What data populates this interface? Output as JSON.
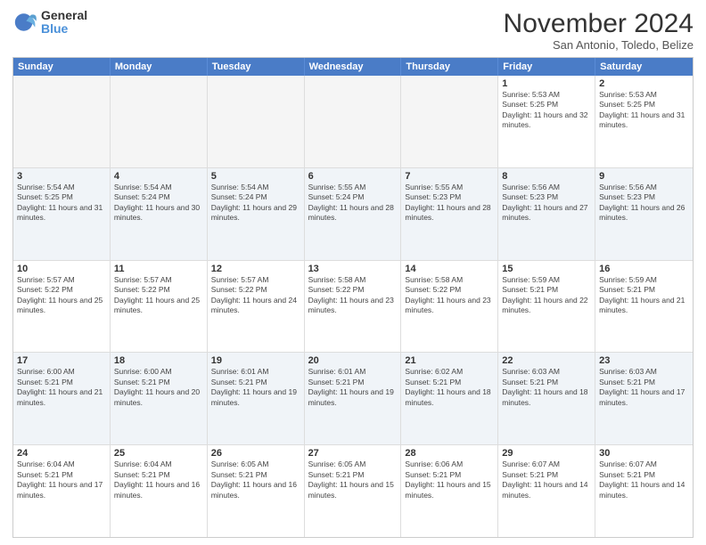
{
  "logo": {
    "line1": "General",
    "line2": "Blue"
  },
  "title": "November 2024",
  "location": "San Antonio, Toledo, Belize",
  "days_of_week": [
    "Sunday",
    "Monday",
    "Tuesday",
    "Wednesday",
    "Thursday",
    "Friday",
    "Saturday"
  ],
  "weeks": [
    [
      {
        "day": "",
        "empty": true
      },
      {
        "day": "",
        "empty": true
      },
      {
        "day": "",
        "empty": true
      },
      {
        "day": "",
        "empty": true
      },
      {
        "day": "",
        "empty": true
      },
      {
        "day": "1",
        "sunrise": "5:53 AM",
        "sunset": "5:25 PM",
        "daylight": "11 hours and 32 minutes."
      },
      {
        "day": "2",
        "sunrise": "5:53 AM",
        "sunset": "5:25 PM",
        "daylight": "11 hours and 31 minutes."
      }
    ],
    [
      {
        "day": "3",
        "sunrise": "5:54 AM",
        "sunset": "5:25 PM",
        "daylight": "11 hours and 31 minutes."
      },
      {
        "day": "4",
        "sunrise": "5:54 AM",
        "sunset": "5:24 PM",
        "daylight": "11 hours and 30 minutes."
      },
      {
        "day": "5",
        "sunrise": "5:54 AM",
        "sunset": "5:24 PM",
        "daylight": "11 hours and 29 minutes."
      },
      {
        "day": "6",
        "sunrise": "5:55 AM",
        "sunset": "5:24 PM",
        "daylight": "11 hours and 28 minutes."
      },
      {
        "day": "7",
        "sunrise": "5:55 AM",
        "sunset": "5:23 PM",
        "daylight": "11 hours and 28 minutes."
      },
      {
        "day": "8",
        "sunrise": "5:56 AM",
        "sunset": "5:23 PM",
        "daylight": "11 hours and 27 minutes."
      },
      {
        "day": "9",
        "sunrise": "5:56 AM",
        "sunset": "5:23 PM",
        "daylight": "11 hours and 26 minutes."
      }
    ],
    [
      {
        "day": "10",
        "sunrise": "5:57 AM",
        "sunset": "5:22 PM",
        "daylight": "11 hours and 25 minutes."
      },
      {
        "day": "11",
        "sunrise": "5:57 AM",
        "sunset": "5:22 PM",
        "daylight": "11 hours and 25 minutes."
      },
      {
        "day": "12",
        "sunrise": "5:57 AM",
        "sunset": "5:22 PM",
        "daylight": "11 hours and 24 minutes."
      },
      {
        "day": "13",
        "sunrise": "5:58 AM",
        "sunset": "5:22 PM",
        "daylight": "11 hours and 23 minutes."
      },
      {
        "day": "14",
        "sunrise": "5:58 AM",
        "sunset": "5:22 PM",
        "daylight": "11 hours and 23 minutes."
      },
      {
        "day": "15",
        "sunrise": "5:59 AM",
        "sunset": "5:21 PM",
        "daylight": "11 hours and 22 minutes."
      },
      {
        "day": "16",
        "sunrise": "5:59 AM",
        "sunset": "5:21 PM",
        "daylight": "11 hours and 21 minutes."
      }
    ],
    [
      {
        "day": "17",
        "sunrise": "6:00 AM",
        "sunset": "5:21 PM",
        "daylight": "11 hours and 21 minutes."
      },
      {
        "day": "18",
        "sunrise": "6:00 AM",
        "sunset": "5:21 PM",
        "daylight": "11 hours and 20 minutes."
      },
      {
        "day": "19",
        "sunrise": "6:01 AM",
        "sunset": "5:21 PM",
        "daylight": "11 hours and 19 minutes."
      },
      {
        "day": "20",
        "sunrise": "6:01 AM",
        "sunset": "5:21 PM",
        "daylight": "11 hours and 19 minutes."
      },
      {
        "day": "21",
        "sunrise": "6:02 AM",
        "sunset": "5:21 PM",
        "daylight": "11 hours and 18 minutes."
      },
      {
        "day": "22",
        "sunrise": "6:03 AM",
        "sunset": "5:21 PM",
        "daylight": "11 hours and 18 minutes."
      },
      {
        "day": "23",
        "sunrise": "6:03 AM",
        "sunset": "5:21 PM",
        "daylight": "11 hours and 17 minutes."
      }
    ],
    [
      {
        "day": "24",
        "sunrise": "6:04 AM",
        "sunset": "5:21 PM",
        "daylight": "11 hours and 17 minutes."
      },
      {
        "day": "25",
        "sunrise": "6:04 AM",
        "sunset": "5:21 PM",
        "daylight": "11 hours and 16 minutes."
      },
      {
        "day": "26",
        "sunrise": "6:05 AM",
        "sunset": "5:21 PM",
        "daylight": "11 hours and 16 minutes."
      },
      {
        "day": "27",
        "sunrise": "6:05 AM",
        "sunset": "5:21 PM",
        "daylight": "11 hours and 15 minutes."
      },
      {
        "day": "28",
        "sunrise": "6:06 AM",
        "sunset": "5:21 PM",
        "daylight": "11 hours and 15 minutes."
      },
      {
        "day": "29",
        "sunrise": "6:07 AM",
        "sunset": "5:21 PM",
        "daylight": "11 hours and 14 minutes."
      },
      {
        "day": "30",
        "sunrise": "6:07 AM",
        "sunset": "5:21 PM",
        "daylight": "11 hours and 14 minutes."
      }
    ]
  ]
}
